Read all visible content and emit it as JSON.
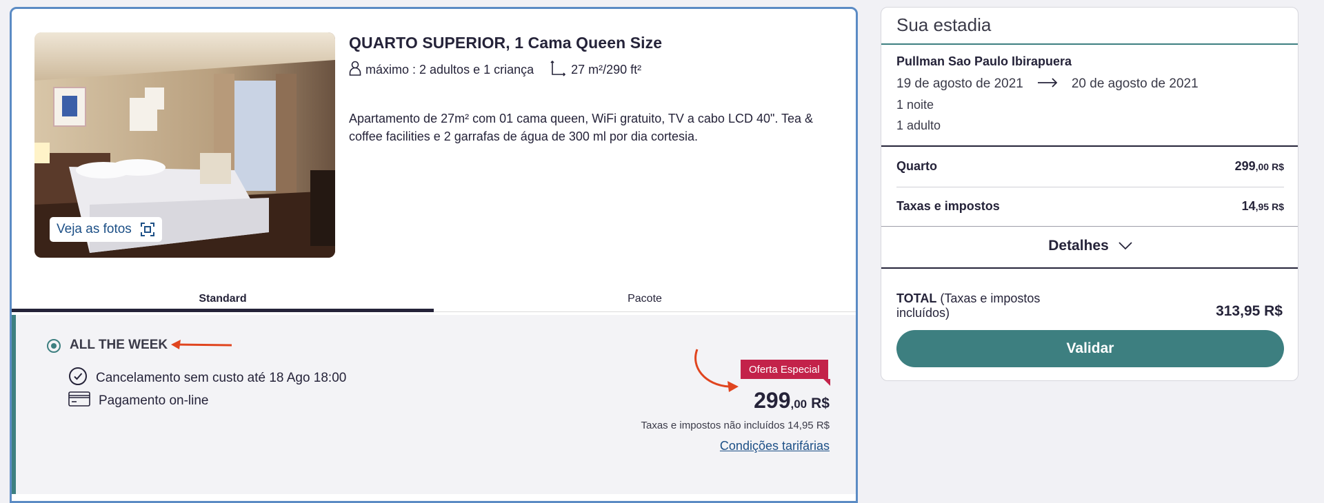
{
  "room": {
    "title": "QUARTO SUPERIOR, 1 Cama Queen Size",
    "capacity": "máximo : 2 adultos e 1 criança",
    "size": "27 m²/290 ft²",
    "description": "Apartamento de 27m² com 01 cama queen, WiFi gratuito, TV a cabo LCD 40\". Tea & coffee facilities e 2 garrafas de água de 300 ml por dia cortesia.",
    "photos_button": "Veja as fotos"
  },
  "tabs": [
    {
      "label": "Standard",
      "active": true
    },
    {
      "label": "Pacote",
      "active": false
    }
  ],
  "offer": {
    "name": "ALL THE WEEK",
    "features": [
      "Cancelamento sem custo até 18 Ago 18:00",
      "Pagamento on-line"
    ],
    "badge": "Oferta Especial",
    "price_int": "299",
    "price_dec": ",00",
    "currency": "R$",
    "tax_note": "Taxas e impostos não incluídos 14,95 R$",
    "conditions_link": "Condições tarifárias"
  },
  "summary": {
    "title": "Sua estadia",
    "hotel": "Pullman Sao Paulo Ibirapuera",
    "check_in": "19 de agosto de 2021",
    "check_out": "20 de agosto de 2021",
    "nights": "1 noite",
    "guests": "1 adulto",
    "lines": [
      {
        "label": "Quarto",
        "int": "299",
        "dec": ",00",
        "cur": "R$"
      },
      {
        "label": "Taxas e impostos",
        "int": "14",
        "dec": ",95",
        "cur": "R$"
      }
    ],
    "details_label": "Detalhes",
    "total_label_bold": "TOTAL",
    "total_label_rest": " (Taxas e impostos incluídos)",
    "total_amount": "313,95 R$",
    "validate_label": "Validar"
  },
  "colors": {
    "accent": "#3d7f80",
    "badge": "#c3224a",
    "link": "#1c4f86",
    "annotation_arrow": "#e0451f",
    "card_border": "#5b8bc4"
  }
}
